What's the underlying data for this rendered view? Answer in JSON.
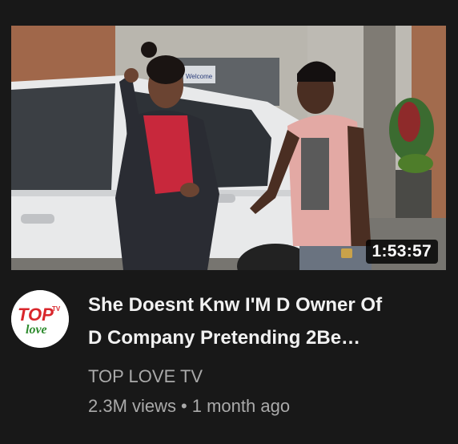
{
  "video": {
    "duration": "1:53:57",
    "title_line1": "She Doesnt Knw I'M D Owner Of",
    "title_line2": "D Company Pretending 2Be…",
    "channel": "TOP LOVE TV",
    "views": "2.3M views",
    "separator": "•",
    "age": "1 month ago"
  },
  "thumbnail": {
    "signs": [
      "Welcome"
    ]
  },
  "avatar": {
    "logo_text_top": "TOP",
    "logo_text_bottom": "love",
    "logo_text_tv": "TV"
  },
  "colors": {
    "background": "#181818",
    "title": "#f1f1f1",
    "meta": "#aaaaaa",
    "logo_red": "#d9262b",
    "logo_green": "#2e8b2e"
  }
}
